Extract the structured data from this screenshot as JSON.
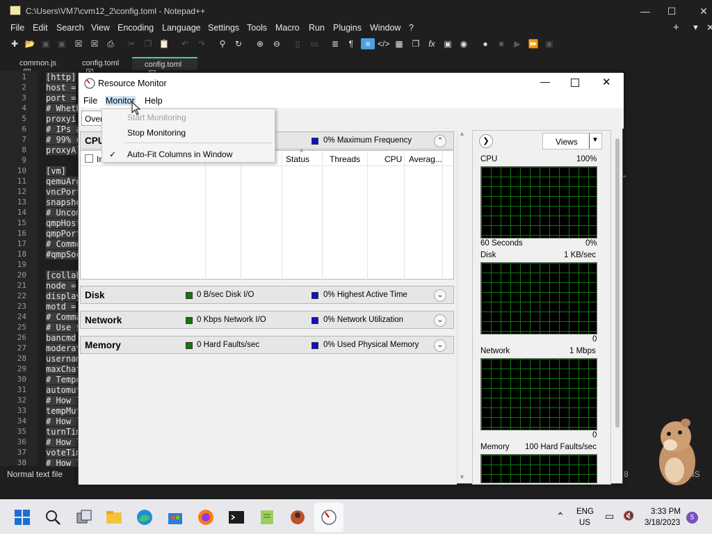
{
  "npp": {
    "title": "C:\\Users\\VM7\\cvm12_2\\config.toml - Notepad++",
    "menu": [
      "File",
      "Edit",
      "Search",
      "View",
      "Encoding",
      "Language",
      "Settings",
      "Tools",
      "Macro",
      "Run",
      "Plugins",
      "Window",
      "?"
    ],
    "tabs": [
      {
        "label": "common.js",
        "active": false
      },
      {
        "label": "config.toml",
        "active": false
      },
      {
        "label": "config.toml",
        "active": true
      }
    ],
    "line_numbers": [
      "1",
      "2",
      "3",
      "4",
      "5",
      "6",
      "7",
      "8",
      "9",
      "10",
      "11",
      "12",
      "13",
      "14",
      "15",
      "16",
      "17",
      "18",
      "19",
      "20",
      "21",
      "22",
      "23",
      "24",
      "25",
      "26",
      "27",
      "28",
      "29",
      "30",
      "31",
      "32",
      "33",
      "34",
      "35",
      "36",
      "37",
      "38"
    ],
    "code_lines": [
      "[http]",
      "host =",
      "port =",
      "# Wheth",
      "proxyi",
      "# IPs a",
      "# 99% c",
      "proxyAl",
      "",
      "[vm]",
      "qemuArg",
      "vncPort",
      "snapsho",
      "# Uncom",
      "qmpHost",
      "qmpPort",
      "# Comme",
      "#qmpSoc",
      "",
      "[collab",
      "node =",
      "display",
      "motd =",
      "# Comma",
      "# Use $",
      "bancmd",
      "moderat",
      "usernam",
      "maxChat",
      "# Tempo",
      "automut",
      "# How l",
      "tempMut",
      "# How l",
      "turnTim",
      "# How l",
      "voteTim",
      "# How l"
    ],
    "status_left": "Normal text file",
    "status_right_1": "8",
    "status_right_2": "NS"
  },
  "resmon": {
    "title": "Resource Monitor",
    "menu": {
      "file": "File",
      "monitor": "Monitor",
      "help": "Help"
    },
    "overview_tab": "Over",
    "cpu": {
      "name": "CPU",
      "metric2": "0% Maximum Frequency",
      "columns": {
        "image": "Im",
        "status": "Status",
        "threads": "Threads",
        "cpu": "CPU",
        "average": "Averag..."
      }
    },
    "disk": {
      "name": "Disk",
      "metric1": "0 B/sec Disk I/O",
      "metric2": "0% Highest Active Time"
    },
    "network": {
      "name": "Network",
      "metric1": "0 Kbps Network I/O",
      "metric2": "0% Network Utilization"
    },
    "memory": {
      "name": "Memory",
      "metric1": "0 Hard Faults/sec",
      "metric2": "0% Used Physical Memory"
    },
    "views_label": "Views",
    "graphs": {
      "cpu": {
        "label": "CPU",
        "max": "100%",
        "footer_left": "60 Seconds",
        "footer_right": "0%"
      },
      "disk": {
        "label": "Disk",
        "max": "1 KB/sec",
        "footer_right": "0"
      },
      "network": {
        "label": "Network",
        "max": "1 Mbps",
        "footer_right": "0"
      },
      "memory": {
        "label": "Memory",
        "max": "100 Hard Faults/sec"
      }
    }
  },
  "monitor_menu": {
    "start": "Start Monitoring",
    "stop": "Stop Monitoring",
    "autofit": "Auto-Fit Columns in Window",
    "checkmark": "✓"
  },
  "taskbar": {
    "lang_line1": "ENG",
    "lang_line2": "US",
    "time": "3:33 PM",
    "date": "3/18/2023",
    "notifications": "5"
  }
}
